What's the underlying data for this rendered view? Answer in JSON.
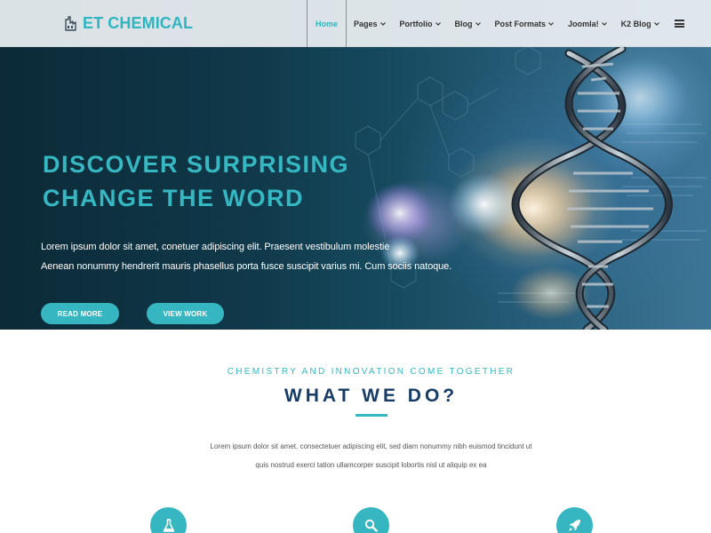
{
  "header": {
    "logo_text": "ET CHEMICAL",
    "logo_icon": "factory-icon",
    "nav": [
      {
        "label": "Home",
        "active": true,
        "has_dropdown": false
      },
      {
        "label": "Pages",
        "has_dropdown": true
      },
      {
        "label": "Portfolio",
        "has_dropdown": true
      },
      {
        "label": "Blog",
        "has_dropdown": true
      },
      {
        "label": "Post Formats",
        "has_dropdown": true
      },
      {
        "label": "Joomla!",
        "has_dropdown": true
      },
      {
        "label": "K2 Blog",
        "has_dropdown": true
      }
    ],
    "menu_icon": "hamburger-menu-icon"
  },
  "hero": {
    "title_line1": "DISCOVER SURPRISING",
    "title_line2": "CHANGE THE WORD",
    "text_line1": "Lorem ipsum dolor sit amet, conetuer adipiscing elit. Praesent vestibulum molestie",
    "text_line2": "Aenean nonummy hendrerit mauris phasellus porta fusce suscipit varius mi. Cum sociis natoque.",
    "btn_more": "READ MORE",
    "btn_work": "VIEW WORK"
  },
  "what_we_do": {
    "kicker": "CHEMISTRY AND INNOVATION COME TOGETHER",
    "title": "WHAT WE DO?",
    "desc_line1": "Lorem ipsum dolor sit amet, consectetuer adipiscing elit, sed diam nonummy nibh euismod tincidunt ut",
    "desc_line2": "quis nostrud exerci tation ullamcorper suscipit lobortis nisl ut aliquip ex ea",
    "icons": [
      "flask-icon",
      "search-icon",
      "rocket-icon"
    ]
  },
  "colors": {
    "accent": "#35b6c1",
    "title_navy": "#173c66",
    "header_bg": "#eceff3"
  }
}
